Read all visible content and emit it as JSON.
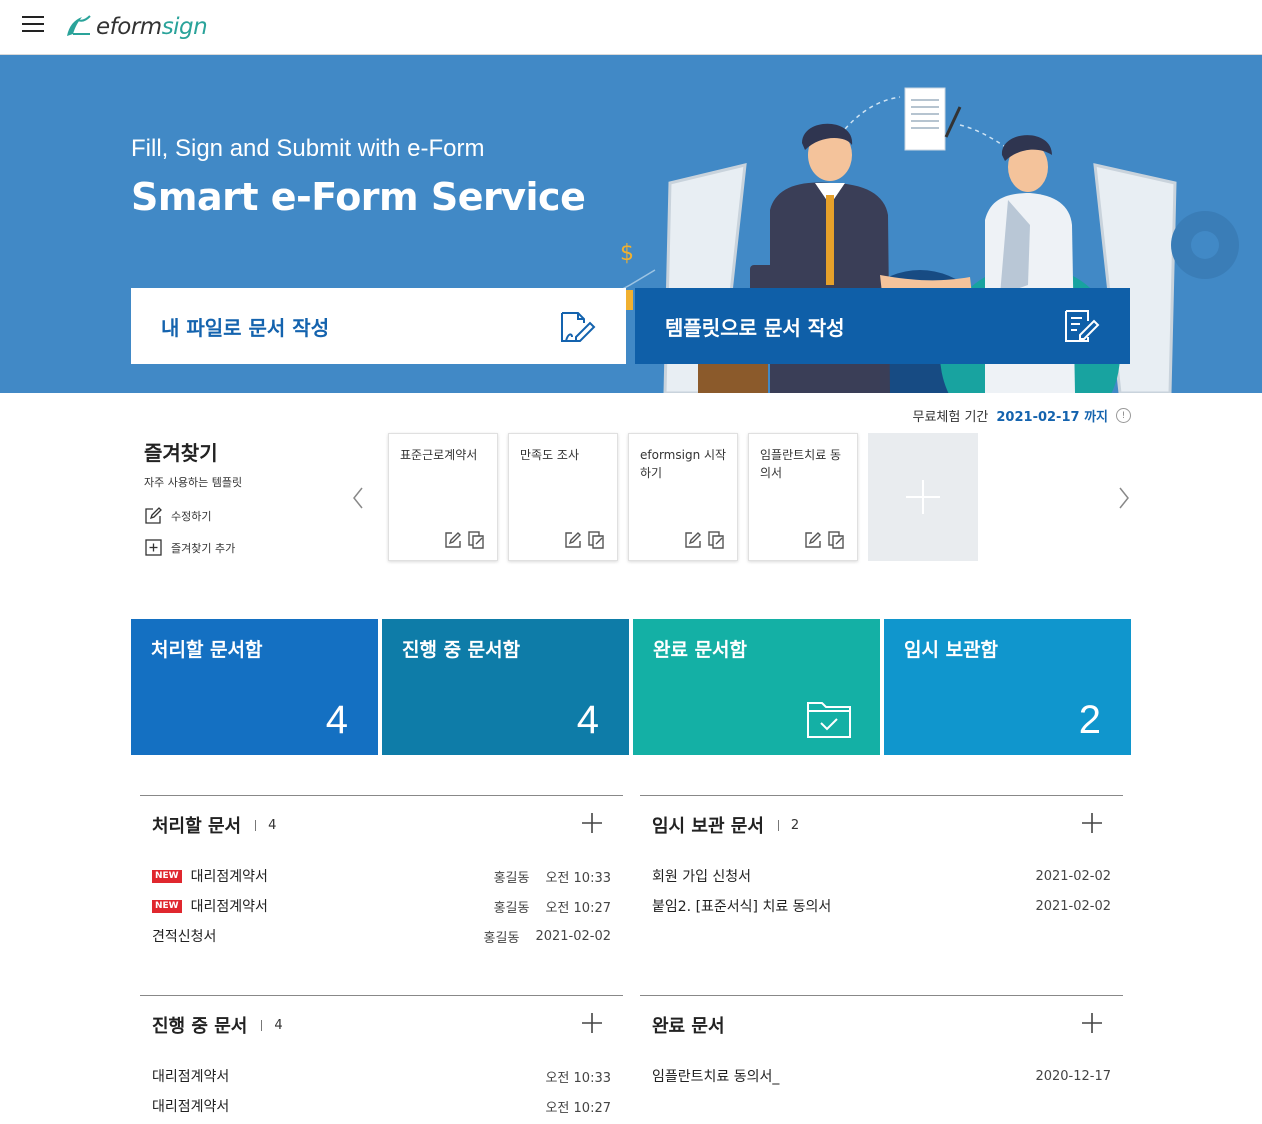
{
  "header": {
    "logo_left": "e",
    "logo_mid": "form",
    "logo_right": "sign"
  },
  "hero": {
    "subtitle": "Fill, Sign and Submit with e-Form",
    "title": "Smart e-Form Service",
    "cta_file": "내 파일로 문서 작성",
    "cta_template": "템플릿으로 문서 작성"
  },
  "trial": {
    "label": "무료체험 기간",
    "date": "2021-02-17 까지"
  },
  "favorites": {
    "title": "즐겨찾기",
    "desc": "자주 사용하는 템플릿",
    "edit": "수정하기",
    "add": "즐겨찾기 추가",
    "cards": [
      "표준근로계약서",
      "만족도 조사",
      "eformsign 시작하기",
      "임플란트치료 동의서"
    ]
  },
  "tiles": [
    {
      "title": "처리할 문서함",
      "count": "4",
      "color": "#1470c2"
    },
    {
      "title": "진행 중 문서함",
      "count": "4",
      "color": "#0e7ca8"
    },
    {
      "title": "완료 문서함",
      "count": "",
      "color": "#14b0a5"
    },
    {
      "title": "임시 보관함",
      "count": "2",
      "color": "#1096cd"
    }
  ],
  "panels": {
    "todo": {
      "title": "처리할 문서",
      "count": "4",
      "rows": [
        {
          "new": "NEW",
          "name": "대리점계약서",
          "who": "홍길동",
          "when": "오전 10:33"
        },
        {
          "new": "NEW",
          "name": "대리점계약서",
          "who": "홍길동",
          "when": "오전 10:27"
        },
        {
          "new": "",
          "name": "견적신청서",
          "who": "홍길동",
          "when": "2021-02-02"
        }
      ]
    },
    "draft": {
      "title": "임시 보관 문서",
      "count": "2",
      "rows": [
        {
          "name": "회원 가입 신청서",
          "when": "2021-02-02"
        },
        {
          "name": "붙임2. [표준서식] 치료 동의서",
          "when": "2021-02-02"
        }
      ]
    },
    "progress": {
      "title": "진행 중 문서",
      "count": "4",
      "rows": [
        {
          "name": "대리점계약서",
          "when": "오전 10:33"
        },
        {
          "name": "대리점계약서",
          "when": "오전 10:27"
        }
      ]
    },
    "done": {
      "title": "완료 문서",
      "rows": [
        {
          "name": "임플란트치료 동의서_",
          "when": "2020-12-17"
        }
      ]
    }
  },
  "icons": [
    "menu-icon",
    "logo-icon",
    "file-edit-icon",
    "template-edit-icon",
    "info-icon",
    "edit-icon",
    "add-box-icon",
    "chevron-left-icon",
    "chevron-right-icon",
    "pencil-icon",
    "copy-icon",
    "plus-icon",
    "folder-check-icon"
  ]
}
